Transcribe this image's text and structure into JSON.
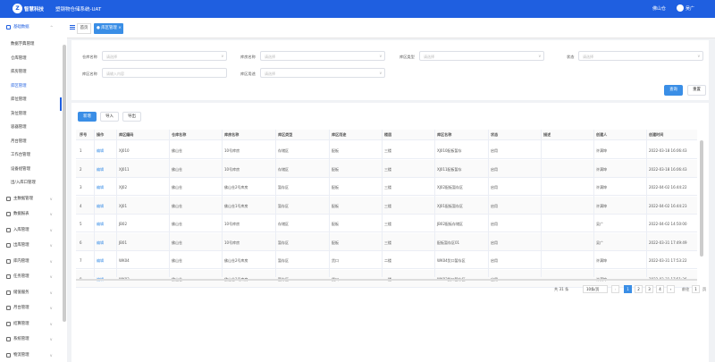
{
  "header": {
    "logo_text": "智慧科技",
    "system_title": "塑钢物仓储系统-UAT",
    "warehouse": "佛山仓",
    "username": "吴广"
  },
  "sidebar": {
    "groups": [
      {
        "label": "基础数据",
        "icon": "database-icon"
      },
      {
        "label": "主数据管理",
        "icon": "master-data-icon"
      },
      {
        "label": "数据报表",
        "icon": "report-icon"
      },
      {
        "label": "入库管理",
        "icon": "inbound-icon"
      },
      {
        "label": "出库管理",
        "icon": "outbound-icon"
      },
      {
        "label": "库内管理",
        "icon": "inventory-icon"
      },
      {
        "label": "任务管理",
        "icon": "task-icon"
      },
      {
        "label": "储值服务",
        "icon": "storage-icon"
      },
      {
        "label": "月台管理",
        "icon": "dock-icon"
      },
      {
        "label": "结算管理",
        "icon": "settlement-icon"
      },
      {
        "label": "系统管理",
        "icon": "system-icon"
      },
      {
        "label": "物流管理",
        "icon": "logistics-icon"
      }
    ],
    "sub_items": [
      "数据字典管理",
      "仓库管理",
      "库房管理",
      "库区管理",
      "库位管理",
      "货位管理",
      "容器管理",
      "月台管理",
      "工作台管理",
      "设备组管理",
      "出/入库口管理"
    ]
  },
  "tabs": {
    "home": "首页",
    "zone": "库区管理"
  },
  "filters": {
    "warehouse_name": {
      "label": "仓库名称",
      "placeholder": "请选择"
    },
    "house_name": {
      "label": "库房名称",
      "placeholder": "请选择"
    },
    "zone_type": {
      "label": "库区类型",
      "placeholder": "请选择"
    },
    "status": {
      "label": "状态",
      "placeholder": "请选择"
    },
    "zone_name": {
      "label": "库区名称",
      "placeholder": "请输入内容"
    },
    "zone_usage": {
      "label": "库区用途",
      "placeholder": "请选择"
    },
    "search_btn": "查询",
    "reset_btn": "重置"
  },
  "toolbar": {
    "add": "新增",
    "import": "导入",
    "export": "导出"
  },
  "table": {
    "headers": [
      "序号",
      "操作",
      "库区编码",
      "仓库名称",
      "库房名称",
      "库区类型",
      "库区用途",
      "楼层",
      "库区名称",
      "状态",
      "描述",
      "创建人",
      "创建时间"
    ],
    "rows": [
      [
        "1",
        "编辑",
        "XJ010",
        "佛山仓",
        "10号库房",
        "存储区",
        "配板",
        "三楼",
        "XJ010配板暂存",
        "启用",
        "",
        "许满坤",
        "2022-03-18 16:06:43"
      ],
      [
        "2",
        "编辑",
        "XJ011",
        "佛山仓",
        "10号库房",
        "存储区",
        "配板",
        "三楼",
        "XJ011配板暂存",
        "启用",
        "",
        "许满坤",
        "2022-03-18 16:06:43"
      ],
      [
        "3",
        "编辑",
        "XJ02",
        "佛山仓",
        "佛山仓2号库房",
        "暂存区",
        "配板",
        "三楼",
        "XJ02配板暂存区",
        "启用",
        "",
        "许满坤",
        "2022-04-02 16:44:22"
      ],
      [
        "4",
        "编辑",
        "XJ01",
        "佛山仓",
        "佛山仓1号库房",
        "暂存区",
        "配板",
        "三楼",
        "XJ01配板暂存区",
        "启用",
        "",
        "许满坤",
        "2022-04-02 16:44:23"
      ],
      [
        "5",
        "编辑",
        "JB02",
        "佛山仓",
        "10号库房",
        "存储区",
        "配板",
        "三楼",
        "JB02配板存储区",
        "启用",
        "",
        "吴广",
        "2022-04-02 14:50:00"
      ],
      [
        "6",
        "编辑",
        "JB01",
        "佛山仓",
        "10号库房",
        "暂存区",
        "配板",
        "三楼",
        "配板暂存区01",
        "启用",
        "",
        "吴广",
        "2022-03-31 17:49:49"
      ],
      [
        "7",
        "编辑",
        "WK04",
        "佛山仓",
        "佛山仓2号库房",
        "暂存区",
        "货口",
        "二楼",
        "WK04货口暂存区",
        "启用",
        "",
        "许满坤",
        "2022-03-31 17:53:22"
      ],
      [
        "8",
        "编辑",
        "WK03",
        "佛山仓",
        "佛山仓1号库房",
        "暂存区",
        "货口",
        "一楼",
        "WK03货口暂存区",
        "启用",
        "",
        "许满坤",
        "2022-03-31 17:51:36"
      ]
    ]
  },
  "pagination": {
    "total": "共 31 条",
    "page_size": "10条/页",
    "pages": [
      "1",
      "2",
      "3",
      "4"
    ],
    "goto_label": "前往",
    "goto_value": "1",
    "page_suffix": "页"
  }
}
